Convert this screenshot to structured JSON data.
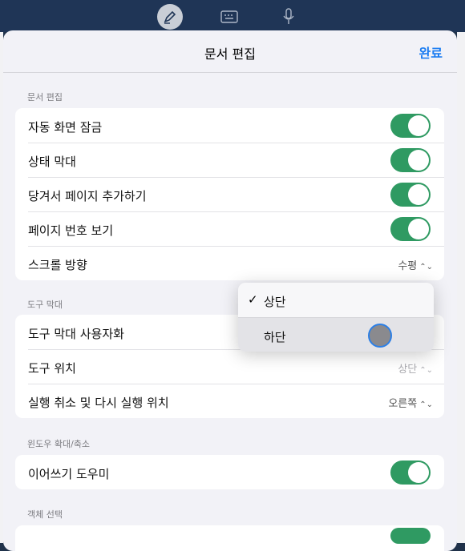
{
  "toolbar": {
    "tools": [
      "pen-icon",
      "keyboard-icon",
      "microphone-icon"
    ]
  },
  "sheet": {
    "title": "문서 편집",
    "done": "완료"
  },
  "section_doc": {
    "header": "문서 편집",
    "rows": [
      {
        "label": "자동 화면 잠금",
        "on": true
      },
      {
        "label": "상태 막대",
        "on": true
      },
      {
        "label": "당겨서 페이지 추가하기",
        "on": true
      },
      {
        "label": "페이지 번호 보기",
        "on": true
      },
      {
        "label": "스크롤 방향",
        "value": "수평"
      }
    ]
  },
  "section_toolbar": {
    "header": "도구 막대",
    "rows": [
      {
        "label": "도구 막대 사용자화"
      },
      {
        "label": "도구 위치",
        "value": "상단"
      },
      {
        "label": "실행 취소 및 다시 실행 위치",
        "value": "오른쪽"
      }
    ]
  },
  "section_window": {
    "header": "윈도우 확대/축소",
    "rows": [
      {
        "label": "이어쓰기 도우미",
        "on": true
      }
    ]
  },
  "section_select": {
    "header": "객체 선택"
  },
  "popup_menu": {
    "items": [
      {
        "label": "상단",
        "checked": true,
        "check_glyph": "✓"
      },
      {
        "label": "하단",
        "checked": false
      }
    ]
  },
  "colors": {
    "toggle_on": "#2f9a62",
    "accent": "#1a7cf2"
  }
}
